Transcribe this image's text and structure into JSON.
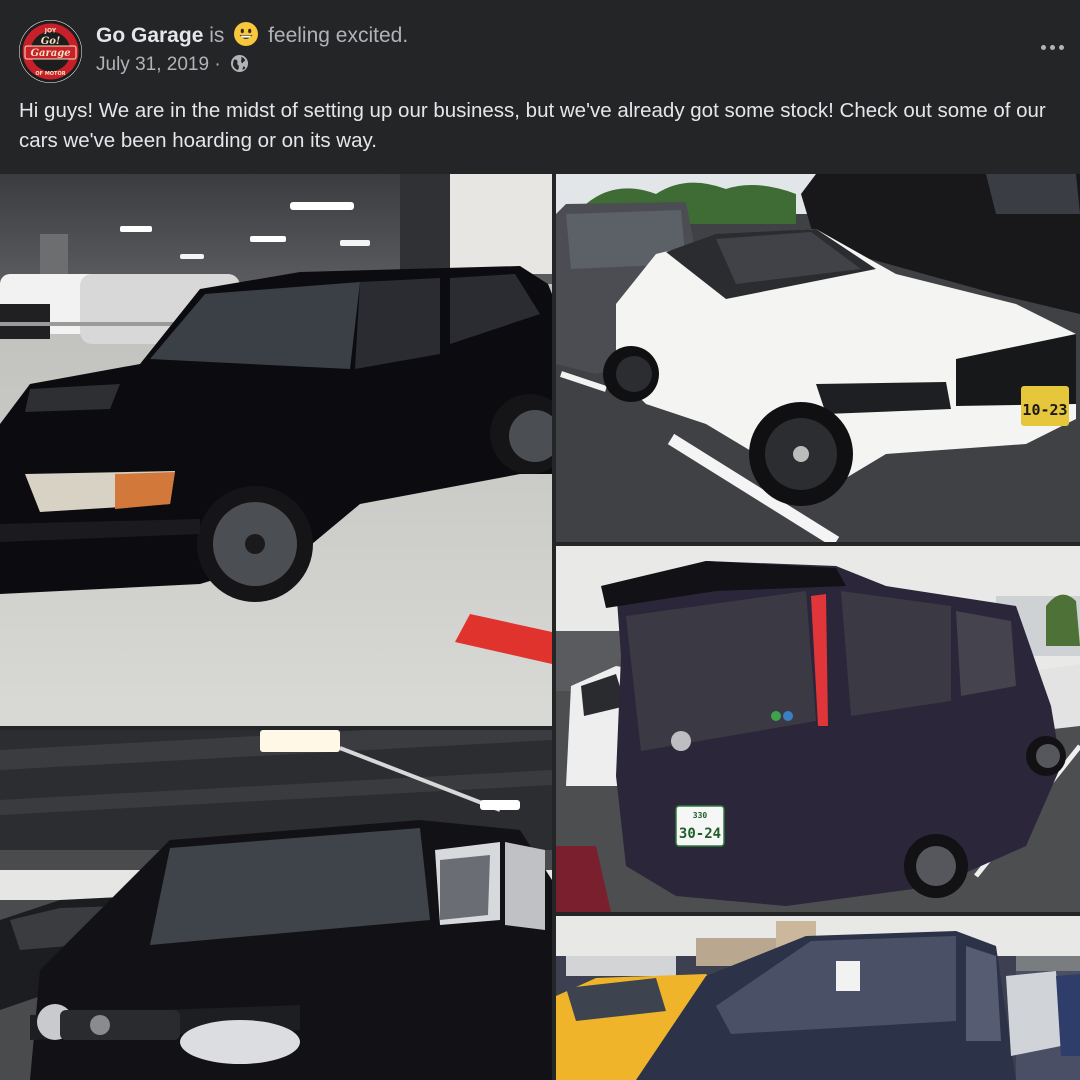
{
  "post": {
    "author": "Go Garage",
    "is_word": "is",
    "feeling_emoji": "grinning-emoji",
    "feeling_text": "feeling excited.",
    "date": "July 31, 2019",
    "separator": "·",
    "privacy_icon": "globe-icon",
    "more_icon": "more-options-icon",
    "text": "Hi guys! We are in the midst of setting up our business, but we've already got some stock! Check out some of our cars we've been hoarding or on its way."
  },
  "avatar": {
    "logo_lines": [
      "JOY",
      "Go!",
      "Garage",
      "OF MOTOR"
    ],
    "ring_color": "#c8202a"
  },
  "photos": [
    {
      "id": "photo-1",
      "subject": "black-station-wagon-in-parking-garage"
    },
    {
      "id": "photo-2",
      "subject": "white-convertible-in-outdoor-lot",
      "plate": "10-23"
    },
    {
      "id": "photo-3",
      "subject": "black-boxy-compact-in-parking-garage"
    },
    {
      "id": "photo-4",
      "subject": "purple-minivan-rear-view",
      "plate": "30-24",
      "plate_top": "330"
    },
    {
      "id": "photo-5",
      "subject": "navy-compact-in-outdoor-lot"
    }
  ],
  "colors": {
    "background": "#242526",
    "primary_text": "#e4e6eb",
    "secondary_text": "#b0b3b8"
  }
}
